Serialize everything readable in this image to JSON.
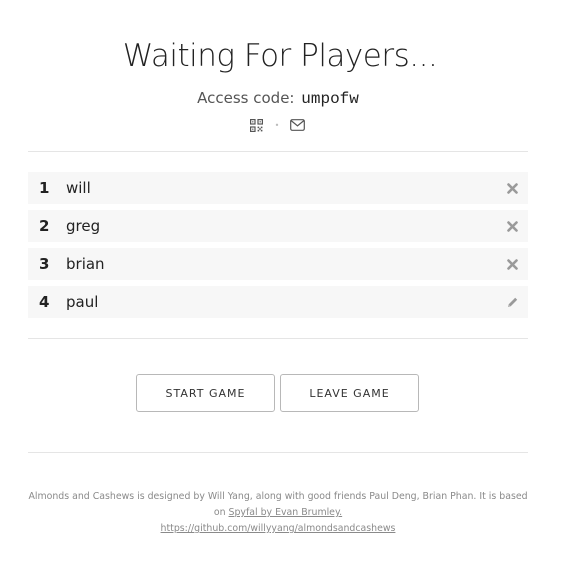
{
  "header": {
    "title": "Waiting For Players...",
    "access_label": "Access code:",
    "access_code": "umpofw",
    "separator": "•"
  },
  "share_icons": [
    "qr-code-icon",
    "mail-icon"
  ],
  "players": [
    {
      "number": "1",
      "name": "will",
      "action_icon": "remove-icon"
    },
    {
      "number": "2",
      "name": "greg",
      "action_icon": "remove-icon"
    },
    {
      "number": "3",
      "name": "brian",
      "action_icon": "remove-icon"
    },
    {
      "number": "4",
      "name": "paul",
      "action_icon": "edit-pencil-icon"
    }
  ],
  "buttons": {
    "start": "START GAME",
    "leave": "LEAVE GAME"
  },
  "footer": {
    "text": "Almonds and Cashews is designed by Will Yang, along with good friends Paul Deng, Brian Phan. It is based on",
    "link_label": "Spyfal by Evan Brumley.",
    "repo_link": "https://github.com/willyyang/almondsandcashews"
  },
  "colors": {
    "row_background": "#f7f7f7",
    "rule": "#e5e5e5",
    "icon": "#9a9a9a"
  }
}
